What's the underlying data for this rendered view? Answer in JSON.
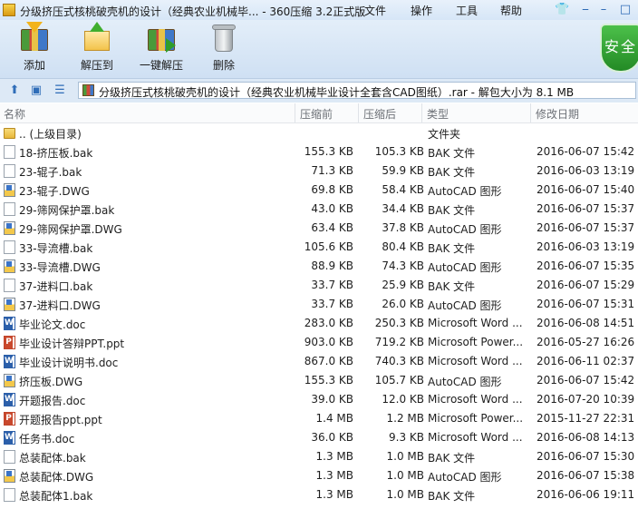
{
  "window": {
    "title": "分级挤压式核桃破壳机的设计（经典农业机械毕... - 360压缩 3.2正式版",
    "menus": [
      "文件",
      "操作",
      "工具",
      "帮助"
    ]
  },
  "toolbar": {
    "add": "添加",
    "extract": "解压到",
    "one_click": "一键解压",
    "delete": "删除",
    "security": "安全"
  },
  "address": {
    "text": "分级挤压式核桃破壳机的设计（经典农业机械毕业设计全套含CAD图纸）.rar - 解包大小为 8.1 MB"
  },
  "columns": {
    "name": "名称",
    "size": "压缩前",
    "packed": "压缩后",
    "type": "类型",
    "modified": "修改日期"
  },
  "files": [
    {
      "icon": "folder",
      "name": ".. (上级目录)",
      "size": "",
      "packed": "",
      "type": "文件夹",
      "date": ""
    },
    {
      "icon": "doc",
      "name": "18-挤压板.bak",
      "size": "155.3 KB",
      "packed": "105.3 KB",
      "type": "BAK 文件",
      "date": "2016-06-07 15:42"
    },
    {
      "icon": "doc",
      "name": "23-辊子.bak",
      "size": "71.3 KB",
      "packed": "59.9 KB",
      "type": "BAK 文件",
      "date": "2016-06-03 13:19"
    },
    {
      "icon": "dwg",
      "name": "23-辊子.DWG",
      "size": "69.8 KB",
      "packed": "58.4 KB",
      "type": "AutoCAD 图形",
      "date": "2016-06-07 15:40"
    },
    {
      "icon": "doc",
      "name": "29-筛网保护罩.bak",
      "size": "43.0 KB",
      "packed": "34.4 KB",
      "type": "BAK 文件",
      "date": "2016-06-07 15:37"
    },
    {
      "icon": "dwg",
      "name": "29-筛网保护罩.DWG",
      "size": "63.4 KB",
      "packed": "37.8 KB",
      "type": "AutoCAD 图形",
      "date": "2016-06-07 15:37"
    },
    {
      "icon": "doc",
      "name": "33-导流槽.bak",
      "size": "105.6 KB",
      "packed": "80.4 KB",
      "type": "BAK 文件",
      "date": "2016-06-03 13:19"
    },
    {
      "icon": "dwg",
      "name": "33-导流槽.DWG",
      "size": "88.9 KB",
      "packed": "74.3 KB",
      "type": "AutoCAD 图形",
      "date": "2016-06-07 15:35"
    },
    {
      "icon": "doc",
      "name": "37-进料口.bak",
      "size": "33.7 KB",
      "packed": "25.9 KB",
      "type": "BAK 文件",
      "date": "2016-06-07 15:29"
    },
    {
      "icon": "dwg",
      "name": "37-进料口.DWG",
      "size": "33.7 KB",
      "packed": "26.0 KB",
      "type": "AutoCAD 图形",
      "date": "2016-06-07 15:31"
    },
    {
      "icon": "word",
      "name": "毕业论文.doc",
      "size": "283.0 KB",
      "packed": "250.3 KB",
      "type": "Microsoft Word ...",
      "date": "2016-06-08 14:51"
    },
    {
      "icon": "ppt",
      "name": "毕业设计答辩PPT.ppt",
      "size": "903.0 KB",
      "packed": "719.2 KB",
      "type": "Microsoft Power...",
      "date": "2016-05-27 16:26"
    },
    {
      "icon": "word",
      "name": "毕业设计说明书.doc",
      "size": "867.0 KB",
      "packed": "740.3 KB",
      "type": "Microsoft Word ...",
      "date": "2016-06-11 02:37"
    },
    {
      "icon": "dwg",
      "name": "挤压板.DWG",
      "size": "155.3 KB",
      "packed": "105.7 KB",
      "type": "AutoCAD 图形",
      "date": "2016-06-07 15:42"
    },
    {
      "icon": "word",
      "name": "开题报告.doc",
      "size": "39.0 KB",
      "packed": "12.0 KB",
      "type": "Microsoft Word ...",
      "date": "2016-07-20 10:39"
    },
    {
      "icon": "ppt",
      "name": "开题报告ppt.ppt",
      "size": "1.4 MB",
      "packed": "1.2 MB",
      "type": "Microsoft Power...",
      "date": "2015-11-27 22:31"
    },
    {
      "icon": "word",
      "name": "任务书.doc",
      "size": "36.0 KB",
      "packed": "9.3 KB",
      "type": "Microsoft Word ...",
      "date": "2016-06-08 14:13"
    },
    {
      "icon": "doc",
      "name": "总装配体.bak",
      "size": "1.3 MB",
      "packed": "1.0 MB",
      "type": "BAK 文件",
      "date": "2016-06-07 15:30"
    },
    {
      "icon": "dwg",
      "name": "总装配体.DWG",
      "size": "1.3 MB",
      "packed": "1.0 MB",
      "type": "AutoCAD 图形",
      "date": "2016-06-07 15:38"
    },
    {
      "icon": "doc",
      "name": "总装配体1.bak",
      "size": "1.3 MB",
      "packed": "1.0 MB",
      "type": "BAK 文件",
      "date": "2016-06-06 19:11"
    }
  ]
}
